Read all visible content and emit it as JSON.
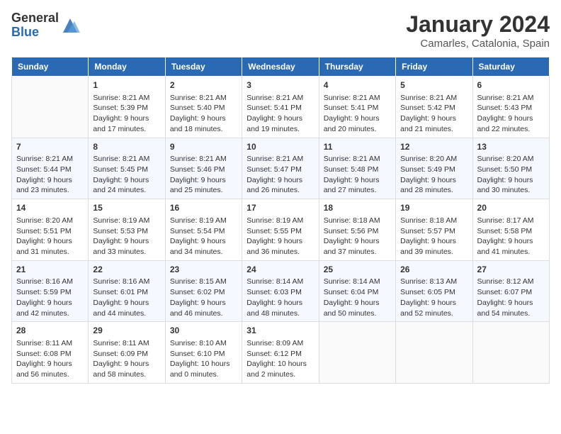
{
  "header": {
    "logo_general": "General",
    "logo_blue": "Blue",
    "month_title": "January 2024",
    "location": "Camarles, Catalonia, Spain"
  },
  "days_of_week": [
    "Sunday",
    "Monday",
    "Tuesday",
    "Wednesday",
    "Thursday",
    "Friday",
    "Saturday"
  ],
  "weeks": [
    [
      {
        "day": "",
        "info": ""
      },
      {
        "day": "1",
        "info": "Sunrise: 8:21 AM\nSunset: 5:39 PM\nDaylight: 9 hours\nand 17 minutes."
      },
      {
        "day": "2",
        "info": "Sunrise: 8:21 AM\nSunset: 5:40 PM\nDaylight: 9 hours\nand 18 minutes."
      },
      {
        "day": "3",
        "info": "Sunrise: 8:21 AM\nSunset: 5:41 PM\nDaylight: 9 hours\nand 19 minutes."
      },
      {
        "day": "4",
        "info": "Sunrise: 8:21 AM\nSunset: 5:41 PM\nDaylight: 9 hours\nand 20 minutes."
      },
      {
        "day": "5",
        "info": "Sunrise: 8:21 AM\nSunset: 5:42 PM\nDaylight: 9 hours\nand 21 minutes."
      },
      {
        "day": "6",
        "info": "Sunrise: 8:21 AM\nSunset: 5:43 PM\nDaylight: 9 hours\nand 22 minutes."
      }
    ],
    [
      {
        "day": "7",
        "info": "Sunrise: 8:21 AM\nSunset: 5:44 PM\nDaylight: 9 hours\nand 23 minutes."
      },
      {
        "day": "8",
        "info": "Sunrise: 8:21 AM\nSunset: 5:45 PM\nDaylight: 9 hours\nand 24 minutes."
      },
      {
        "day": "9",
        "info": "Sunrise: 8:21 AM\nSunset: 5:46 PM\nDaylight: 9 hours\nand 25 minutes."
      },
      {
        "day": "10",
        "info": "Sunrise: 8:21 AM\nSunset: 5:47 PM\nDaylight: 9 hours\nand 26 minutes."
      },
      {
        "day": "11",
        "info": "Sunrise: 8:21 AM\nSunset: 5:48 PM\nDaylight: 9 hours\nand 27 minutes."
      },
      {
        "day": "12",
        "info": "Sunrise: 8:20 AM\nSunset: 5:49 PM\nDaylight: 9 hours\nand 28 minutes."
      },
      {
        "day": "13",
        "info": "Sunrise: 8:20 AM\nSunset: 5:50 PM\nDaylight: 9 hours\nand 30 minutes."
      }
    ],
    [
      {
        "day": "14",
        "info": "Sunrise: 8:20 AM\nSunset: 5:51 PM\nDaylight: 9 hours\nand 31 minutes."
      },
      {
        "day": "15",
        "info": "Sunrise: 8:19 AM\nSunset: 5:53 PM\nDaylight: 9 hours\nand 33 minutes."
      },
      {
        "day": "16",
        "info": "Sunrise: 8:19 AM\nSunset: 5:54 PM\nDaylight: 9 hours\nand 34 minutes."
      },
      {
        "day": "17",
        "info": "Sunrise: 8:19 AM\nSunset: 5:55 PM\nDaylight: 9 hours\nand 36 minutes."
      },
      {
        "day": "18",
        "info": "Sunrise: 8:18 AM\nSunset: 5:56 PM\nDaylight: 9 hours\nand 37 minutes."
      },
      {
        "day": "19",
        "info": "Sunrise: 8:18 AM\nSunset: 5:57 PM\nDaylight: 9 hours\nand 39 minutes."
      },
      {
        "day": "20",
        "info": "Sunrise: 8:17 AM\nSunset: 5:58 PM\nDaylight: 9 hours\nand 41 minutes."
      }
    ],
    [
      {
        "day": "21",
        "info": "Sunrise: 8:16 AM\nSunset: 5:59 PM\nDaylight: 9 hours\nand 42 minutes."
      },
      {
        "day": "22",
        "info": "Sunrise: 8:16 AM\nSunset: 6:01 PM\nDaylight: 9 hours\nand 44 minutes."
      },
      {
        "day": "23",
        "info": "Sunrise: 8:15 AM\nSunset: 6:02 PM\nDaylight: 9 hours\nand 46 minutes."
      },
      {
        "day": "24",
        "info": "Sunrise: 8:14 AM\nSunset: 6:03 PM\nDaylight: 9 hours\nand 48 minutes."
      },
      {
        "day": "25",
        "info": "Sunrise: 8:14 AM\nSunset: 6:04 PM\nDaylight: 9 hours\nand 50 minutes."
      },
      {
        "day": "26",
        "info": "Sunrise: 8:13 AM\nSunset: 6:05 PM\nDaylight: 9 hours\nand 52 minutes."
      },
      {
        "day": "27",
        "info": "Sunrise: 8:12 AM\nSunset: 6:07 PM\nDaylight: 9 hours\nand 54 minutes."
      }
    ],
    [
      {
        "day": "28",
        "info": "Sunrise: 8:11 AM\nSunset: 6:08 PM\nDaylight: 9 hours\nand 56 minutes."
      },
      {
        "day": "29",
        "info": "Sunrise: 8:11 AM\nSunset: 6:09 PM\nDaylight: 9 hours\nand 58 minutes."
      },
      {
        "day": "30",
        "info": "Sunrise: 8:10 AM\nSunset: 6:10 PM\nDaylight: 10 hours\nand 0 minutes."
      },
      {
        "day": "31",
        "info": "Sunrise: 8:09 AM\nSunset: 6:12 PM\nDaylight: 10 hours\nand 2 minutes."
      },
      {
        "day": "",
        "info": ""
      },
      {
        "day": "",
        "info": ""
      },
      {
        "day": "",
        "info": ""
      }
    ]
  ]
}
